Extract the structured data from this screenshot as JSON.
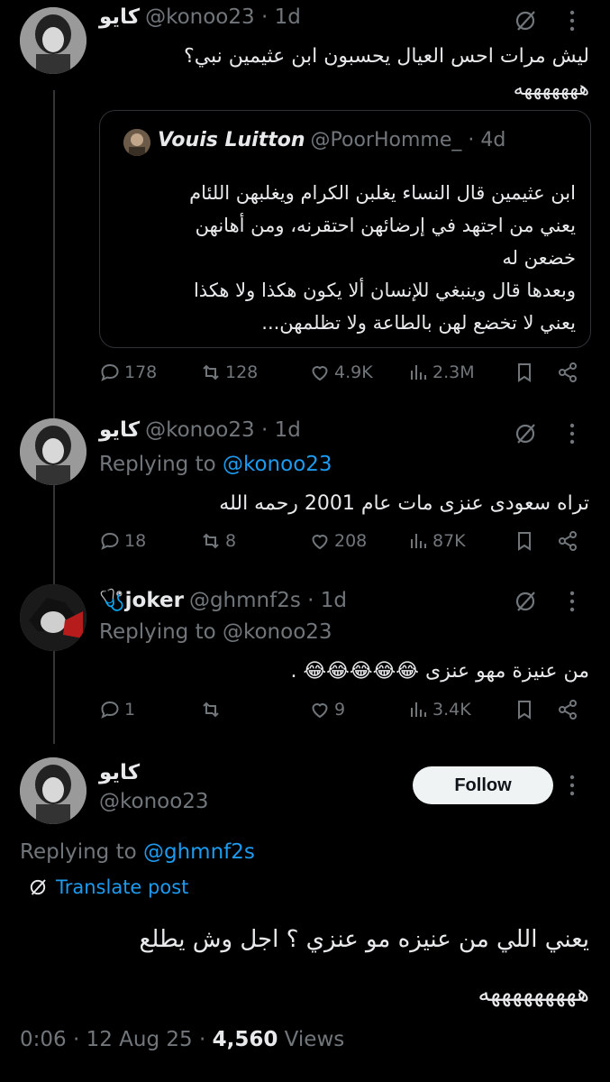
{
  "tweets": [
    {
      "name": "كايو",
      "handle": "@konoo23",
      "time": "· 1d",
      "text1": "ليش مرات احس العيال يحسبون ابن عثيمين نبي؟",
      "text2": "هههههههه",
      "quote": {
        "name": "Vouis Luitton",
        "handle": "@PoorHomme_",
        "time": "· 4d",
        "lines": [
          "ابن عثيمين قال النساء يغلبن الكرام ويغلبهن اللئام",
          "يعني من اجتهد في إرضائهن احتقرنه، ومن أهانهن",
          "خضعن له",
          "وبعدها قال وينبغي للإنسان ألا يكون هكذا ولا هكذا",
          "يعني لا تخضع لهن بالطاعة ولا تظلمهن..."
        ]
      },
      "stats": {
        "replies": "178",
        "reposts": "128",
        "likes": "4.9K",
        "views": "2.3M"
      }
    },
    {
      "name": "كايو",
      "handle": "@konoo23",
      "time": "· 1d",
      "replying_prefix": "Replying to",
      "replying_to": "@konoo23",
      "text": "تراه سعودى عنزى مات عام 2001 رحمه الله",
      "stats": {
        "replies": "18",
        "reposts": "8",
        "likes": "208",
        "views": "87K"
      }
    },
    {
      "name": "joker",
      "name_emoji": "🩺",
      "handle": "@ghmnf2s",
      "time": "· 1d",
      "replying_prefix": "Replying to",
      "replying_to": "@konoo23",
      "text": "من عنيزة مهو عنزى 😂😂😂😂😂 .",
      "stats": {
        "replies": "1",
        "reposts": "",
        "likes": "9",
        "views": "3.4K"
      }
    }
  ],
  "main_post": {
    "name": "كايو",
    "handle": "@konoo23",
    "follow_label": "Follow",
    "replying_prefix": "Replying to",
    "replying_to": "@ghmnf2s",
    "translate_label": "Translate post",
    "text1": "يعني اللي من عنيزه مو عنزي ؟ اجل وش يطلع",
    "text2": "هههههههههه",
    "meta_time": "0:06 · 12 Aug 25 ·",
    "meta_views_count": "4,560",
    "meta_views_label": "Views"
  },
  "colors": {
    "background": "#000000",
    "text": "#e7e9ea",
    "muted": "#71767b",
    "link": "#1d9bf0"
  }
}
